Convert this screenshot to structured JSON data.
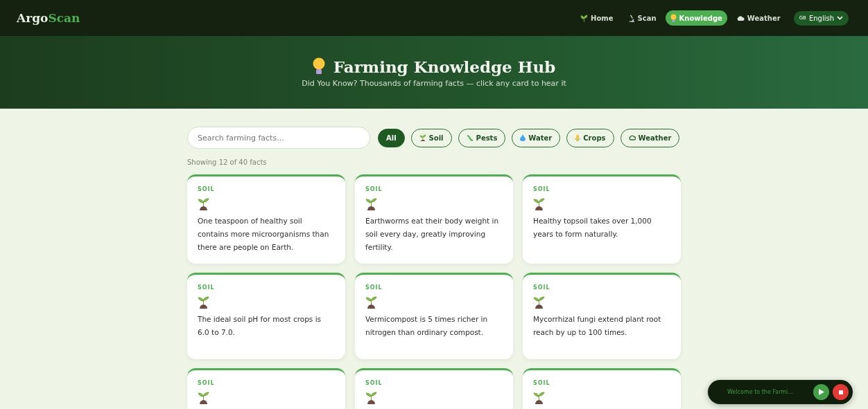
{
  "brand": {
    "part1": "Argo",
    "part2": "Scan"
  },
  "nav": [
    {
      "kind": "home",
      "label": "Home",
      "selected": false
    },
    {
      "kind": "scan",
      "label": "Scan",
      "selected": false
    },
    {
      "kind": "knowledge",
      "label": "Knowledge",
      "selected": true
    },
    {
      "kind": "weather",
      "label": "Weather",
      "selected": false
    }
  ],
  "language": {
    "flag": "GB",
    "label": "English"
  },
  "hero": {
    "title": "Farming Knowledge Hub",
    "subtitle": "Did You Know? Thousands of farming facts — click any card to hear it"
  },
  "search": {
    "placeholder": "Search farming facts..."
  },
  "filters": [
    {
      "kind": "all",
      "label": "All",
      "selected": true
    },
    {
      "kind": "soil",
      "label": "Soil",
      "selected": false
    },
    {
      "kind": "pests",
      "label": "Pests",
      "selected": false
    },
    {
      "kind": "water",
      "label": "Water",
      "selected": false
    },
    {
      "kind": "crops",
      "label": "Crops",
      "selected": false
    },
    {
      "kind": "weather",
      "label": "Weather",
      "selected": false
    }
  ],
  "count": "Showing 12 of 40 facts",
  "cards": [
    {
      "category": "SOIL",
      "kind": "soil",
      "text": "One teaspoon of healthy soil contains more microorganisms than there are people on Earth."
    },
    {
      "category": "SOIL",
      "kind": "soil",
      "text": "Earthworms eat their body weight in soil every day, greatly improving fertility."
    },
    {
      "category": "SOIL",
      "kind": "soil",
      "text": "Healthy topsoil takes over 1,000 years to form naturally."
    },
    {
      "category": "SOIL",
      "kind": "soil",
      "text": "The ideal soil pH for most crops is 6.0 to 7.0."
    },
    {
      "category": "SOIL",
      "kind": "soil",
      "text": "Vermicompost is 5 times richer in nitrogen than ordinary compost."
    },
    {
      "category": "SOIL",
      "kind": "soil",
      "text": "Mycorrhizal fungi extend plant root reach by up to 100 times."
    },
    {
      "category": "SOIL",
      "kind": "soil"
    },
    {
      "category": "SOIL",
      "kind": "soil"
    },
    {
      "category": "SOIL",
      "kind": "soil"
    }
  ],
  "player": {
    "text": "Welcome to the Farmi..."
  }
}
